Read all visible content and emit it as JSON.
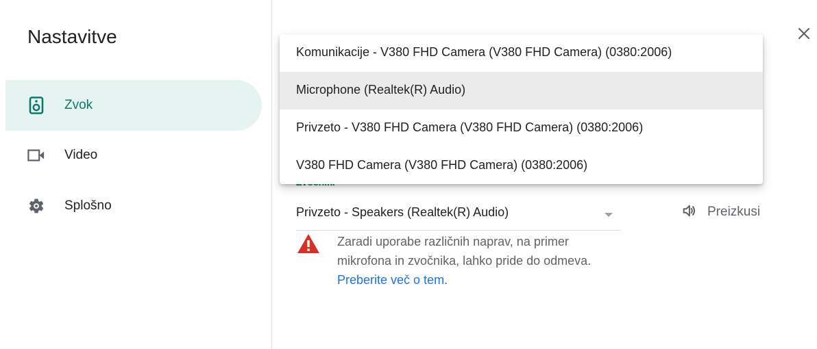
{
  "dialog": {
    "title": "Nastavitve",
    "close_icon": "close-icon"
  },
  "sidebar": {
    "items": [
      {
        "label": "Zvok",
        "icon": "speaker-icon",
        "active": true
      },
      {
        "label": "Video",
        "icon": "videocam-icon",
        "active": false
      },
      {
        "label": "Splošno",
        "icon": "gear-icon",
        "active": false
      }
    ]
  },
  "microphone": {
    "options": [
      "Komunikacije - V380 FHD Camera (V380 FHD Camera) (0380:2006)",
      "Microphone (Realtek(R) Audio)",
      "Privzeto - V380 FHD Camera (V380 FHD Camera) (0380:2006)",
      "V380 FHD Camera (V380 FHD Camera) (0380:2006)"
    ],
    "highlighted_index": 1
  },
  "speakers": {
    "label": "Zvočniki",
    "selected": "Privzeto - Speakers (Realtek(R) Audio)",
    "test_label": "Preizkusi",
    "test_icon": "volume-icon"
  },
  "warning": {
    "icon": "warning-icon",
    "text": "Zaradi uporabe različnih naprav, na primer mikrofona in zvočnika, lahko pride do odmeva.",
    "link_text": "Preberite več o tem"
  },
  "colors": {
    "accent": "#0b7a6a",
    "active_bg": "#e6f4f1",
    "link": "#1a73e8",
    "warning": "#d93025"
  }
}
